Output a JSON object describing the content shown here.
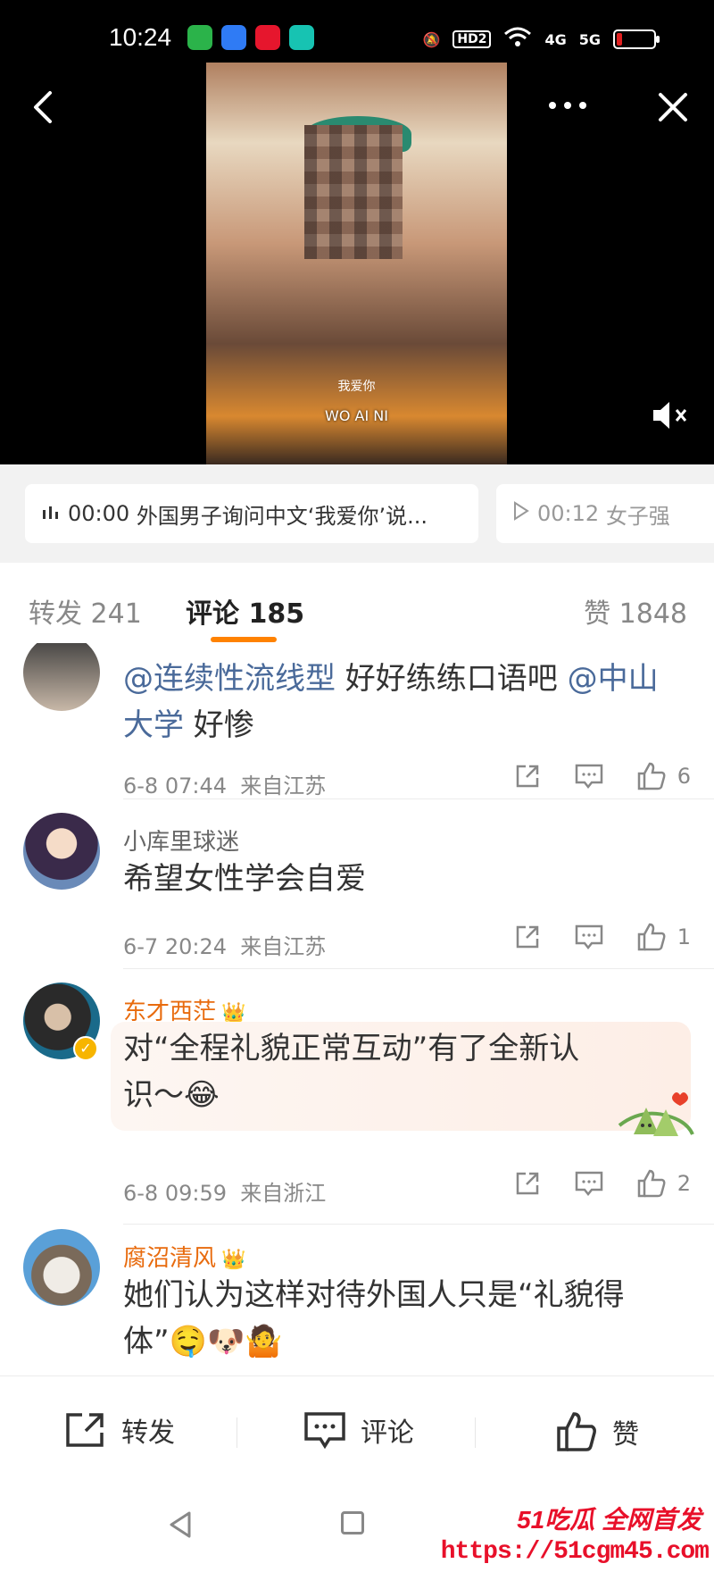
{
  "status_bar": {
    "time": "10:24",
    "network_labels": [
      "HD2",
      "4G",
      "5G"
    ],
    "battery_percent": 15,
    "battery_color": "#e02020"
  },
  "video": {
    "subtitle_cn": "我爱你",
    "subtitle_en": "WO AI NI",
    "muted": true
  },
  "chapters": [
    {
      "time": "00:00",
      "title": "外国男子询问中文‘我爱你’说...",
      "icon": "bars-icon"
    },
    {
      "time": "00:12",
      "title": "女子强",
      "icon": "play-icon"
    }
  ],
  "tabs": {
    "repost": "转发 241",
    "comment": "评论 185",
    "like": "赞 1848",
    "accent_color": "#ff8200"
  },
  "comments": [
    {
      "user": "",
      "text_parts": [
        {
          "text": "@连续性流线型",
          "mention": true
        },
        {
          "text": " 好好练练口语吧 ",
          "mention": false
        },
        {
          "text": "@中山大学",
          "mention": true
        },
        {
          "text": " 好惨",
          "mention": false
        }
      ],
      "date": "6-8 07:44",
      "location": "来自江苏",
      "likes": "6"
    },
    {
      "user": "小库里球迷",
      "text": "希望女性学会自爱",
      "date": "6-7 20:24",
      "location": "来自江苏",
      "likes": "1"
    },
    {
      "user": "东才西茫",
      "vip": true,
      "text": "对“全程礼貌正常互动”有了全新认识～😂",
      "date": "6-8 09:59",
      "location": "来自浙江",
      "likes": "2"
    },
    {
      "user": "腐沼清风",
      "vip": true,
      "text": "她们认为这样对待外国人只是“礼貌得体”🤤🐶🤷",
      "date": "",
      "location": "",
      "likes": ""
    }
  ],
  "toolbar": {
    "repost": "转发",
    "comment": "评论",
    "like": "赞"
  },
  "watermark": {
    "top": "51吃瓜 全网首发",
    "bottom": "https://51cgm45.com"
  }
}
